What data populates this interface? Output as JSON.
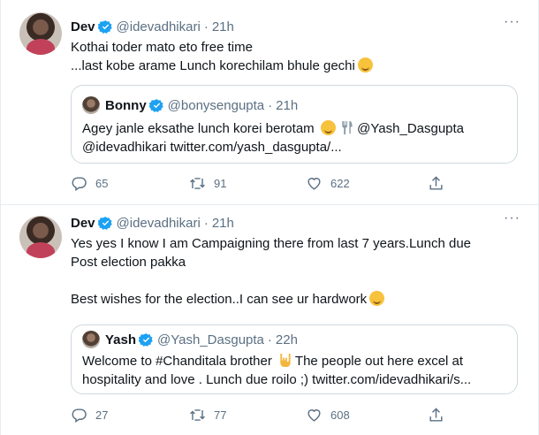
{
  "tweets": [
    {
      "name": "Dev",
      "handle": "@idevadhikari",
      "separator": "·",
      "time": "21h",
      "lines": [
        "Kothai toder mato eto free time",
        "...last kobe arame Lunch korechilam bhule gechi"
      ],
      "emoji_icons": [
        "shushing-face-icon"
      ],
      "quote": {
        "name": "Bonny",
        "handle": "@bonysengupta",
        "separator": "·",
        "time": "21h",
        "line1_prefix": "Agey janle eksathe lunch korei berotam",
        "line1_mention": "@Yash_Dasgupta",
        "line2": "@idevadhikari twitter.com/yash_dasgupta/...",
        "emoji_icons": [
          "winking-tongue-face-icon",
          "fork-knife-icon"
        ]
      },
      "stats": {
        "replies": "65",
        "retweets": "91",
        "likes": "622"
      }
    },
    {
      "name": "Dev",
      "handle": "@idevadhikari",
      "separator": "·",
      "time": "21h",
      "lines": [
        "Yes yes I know I am Campaigning there from last 7 years.Lunch due",
        "Post election pakka",
        "Best wishes for the election..I can see ur hardwork"
      ],
      "emoji_icons": [
        "slightly-smiling-face-icon"
      ],
      "quote": {
        "name": "Yash",
        "handle": "@Yash_Dasgupta",
        "separator": "·",
        "time": "22h",
        "line1_prefix": "Welcome to #Chanditala brother",
        "line1_suffix": "The people out here excel at",
        "line2": "hospitality and love . Lunch due roilo ;) twitter.com/idevadhikari/s...",
        "emoji_icons": [
          "rock-on-hand-icon"
        ]
      },
      "stats": {
        "replies": "27",
        "retweets": "77",
        "likes": "608"
      }
    }
  ],
  "colors": {
    "verified": "#1da1f2",
    "muted": "#5b7083",
    "border": "#cfd9de",
    "text": "#0f1419"
  }
}
